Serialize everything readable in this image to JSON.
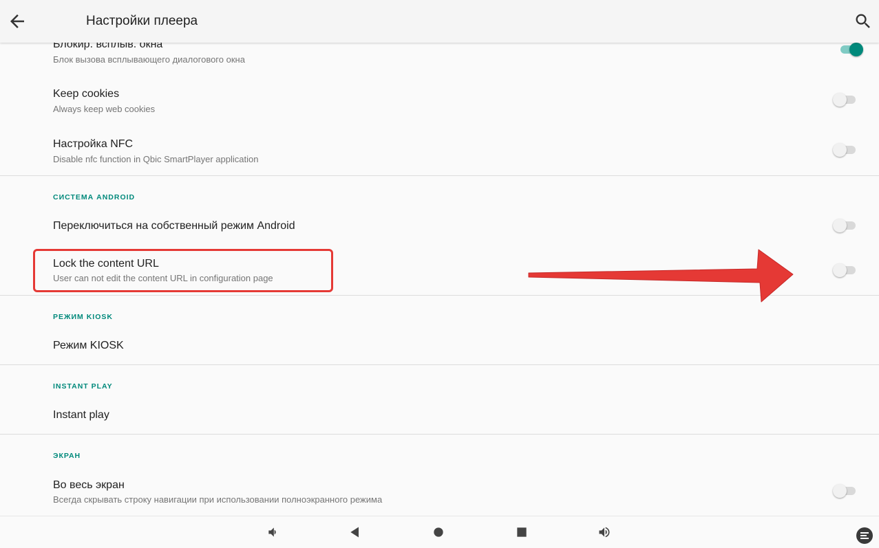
{
  "appbar": {
    "title": "Настройки плеера",
    "back_icon": "arrow-back-icon",
    "search_icon": "search-icon"
  },
  "prefs": {
    "popup_block": {
      "title": "Блокир. всплыв. окна",
      "summary": "Блок вызова всплывающего диалогового окна",
      "enabled": true
    },
    "keep_cookies": {
      "title": "Keep cookies",
      "summary": "Always keep web cookies",
      "enabled": false
    },
    "nfc": {
      "title": "Настройка NFC",
      "summary": "Disable nfc function in Qbic SmartPlayer application",
      "enabled": false
    }
  },
  "android": {
    "category": "СИСТЕМА ANDROID",
    "native_mode": {
      "title": "Переключиться на собственный режим Android",
      "enabled": false
    },
    "lock_url": {
      "title": "Lock the content URL",
      "summary": "User can not edit the content URL in configuration page",
      "enabled": false
    }
  },
  "kiosk": {
    "category": "РЕЖИМ KIOSK",
    "title": "Режим KIOSK"
  },
  "instant": {
    "category": "INSTANT PLAY",
    "title": "Instant play"
  },
  "screen": {
    "category": "ЭКРАН",
    "fullscreen": {
      "title": "Во весь экран",
      "summary": "Всегда скрывать строку навигации при использовании полноэкранного режима",
      "enabled": false
    }
  },
  "colors": {
    "accent": "#00897b",
    "annotation": "#e53935"
  },
  "navbar": {
    "icons": [
      "volume-down-icon",
      "back-triangle-icon",
      "home-circle-icon",
      "recents-square-icon",
      "volume-up-icon",
      "screenshot-icon"
    ]
  }
}
